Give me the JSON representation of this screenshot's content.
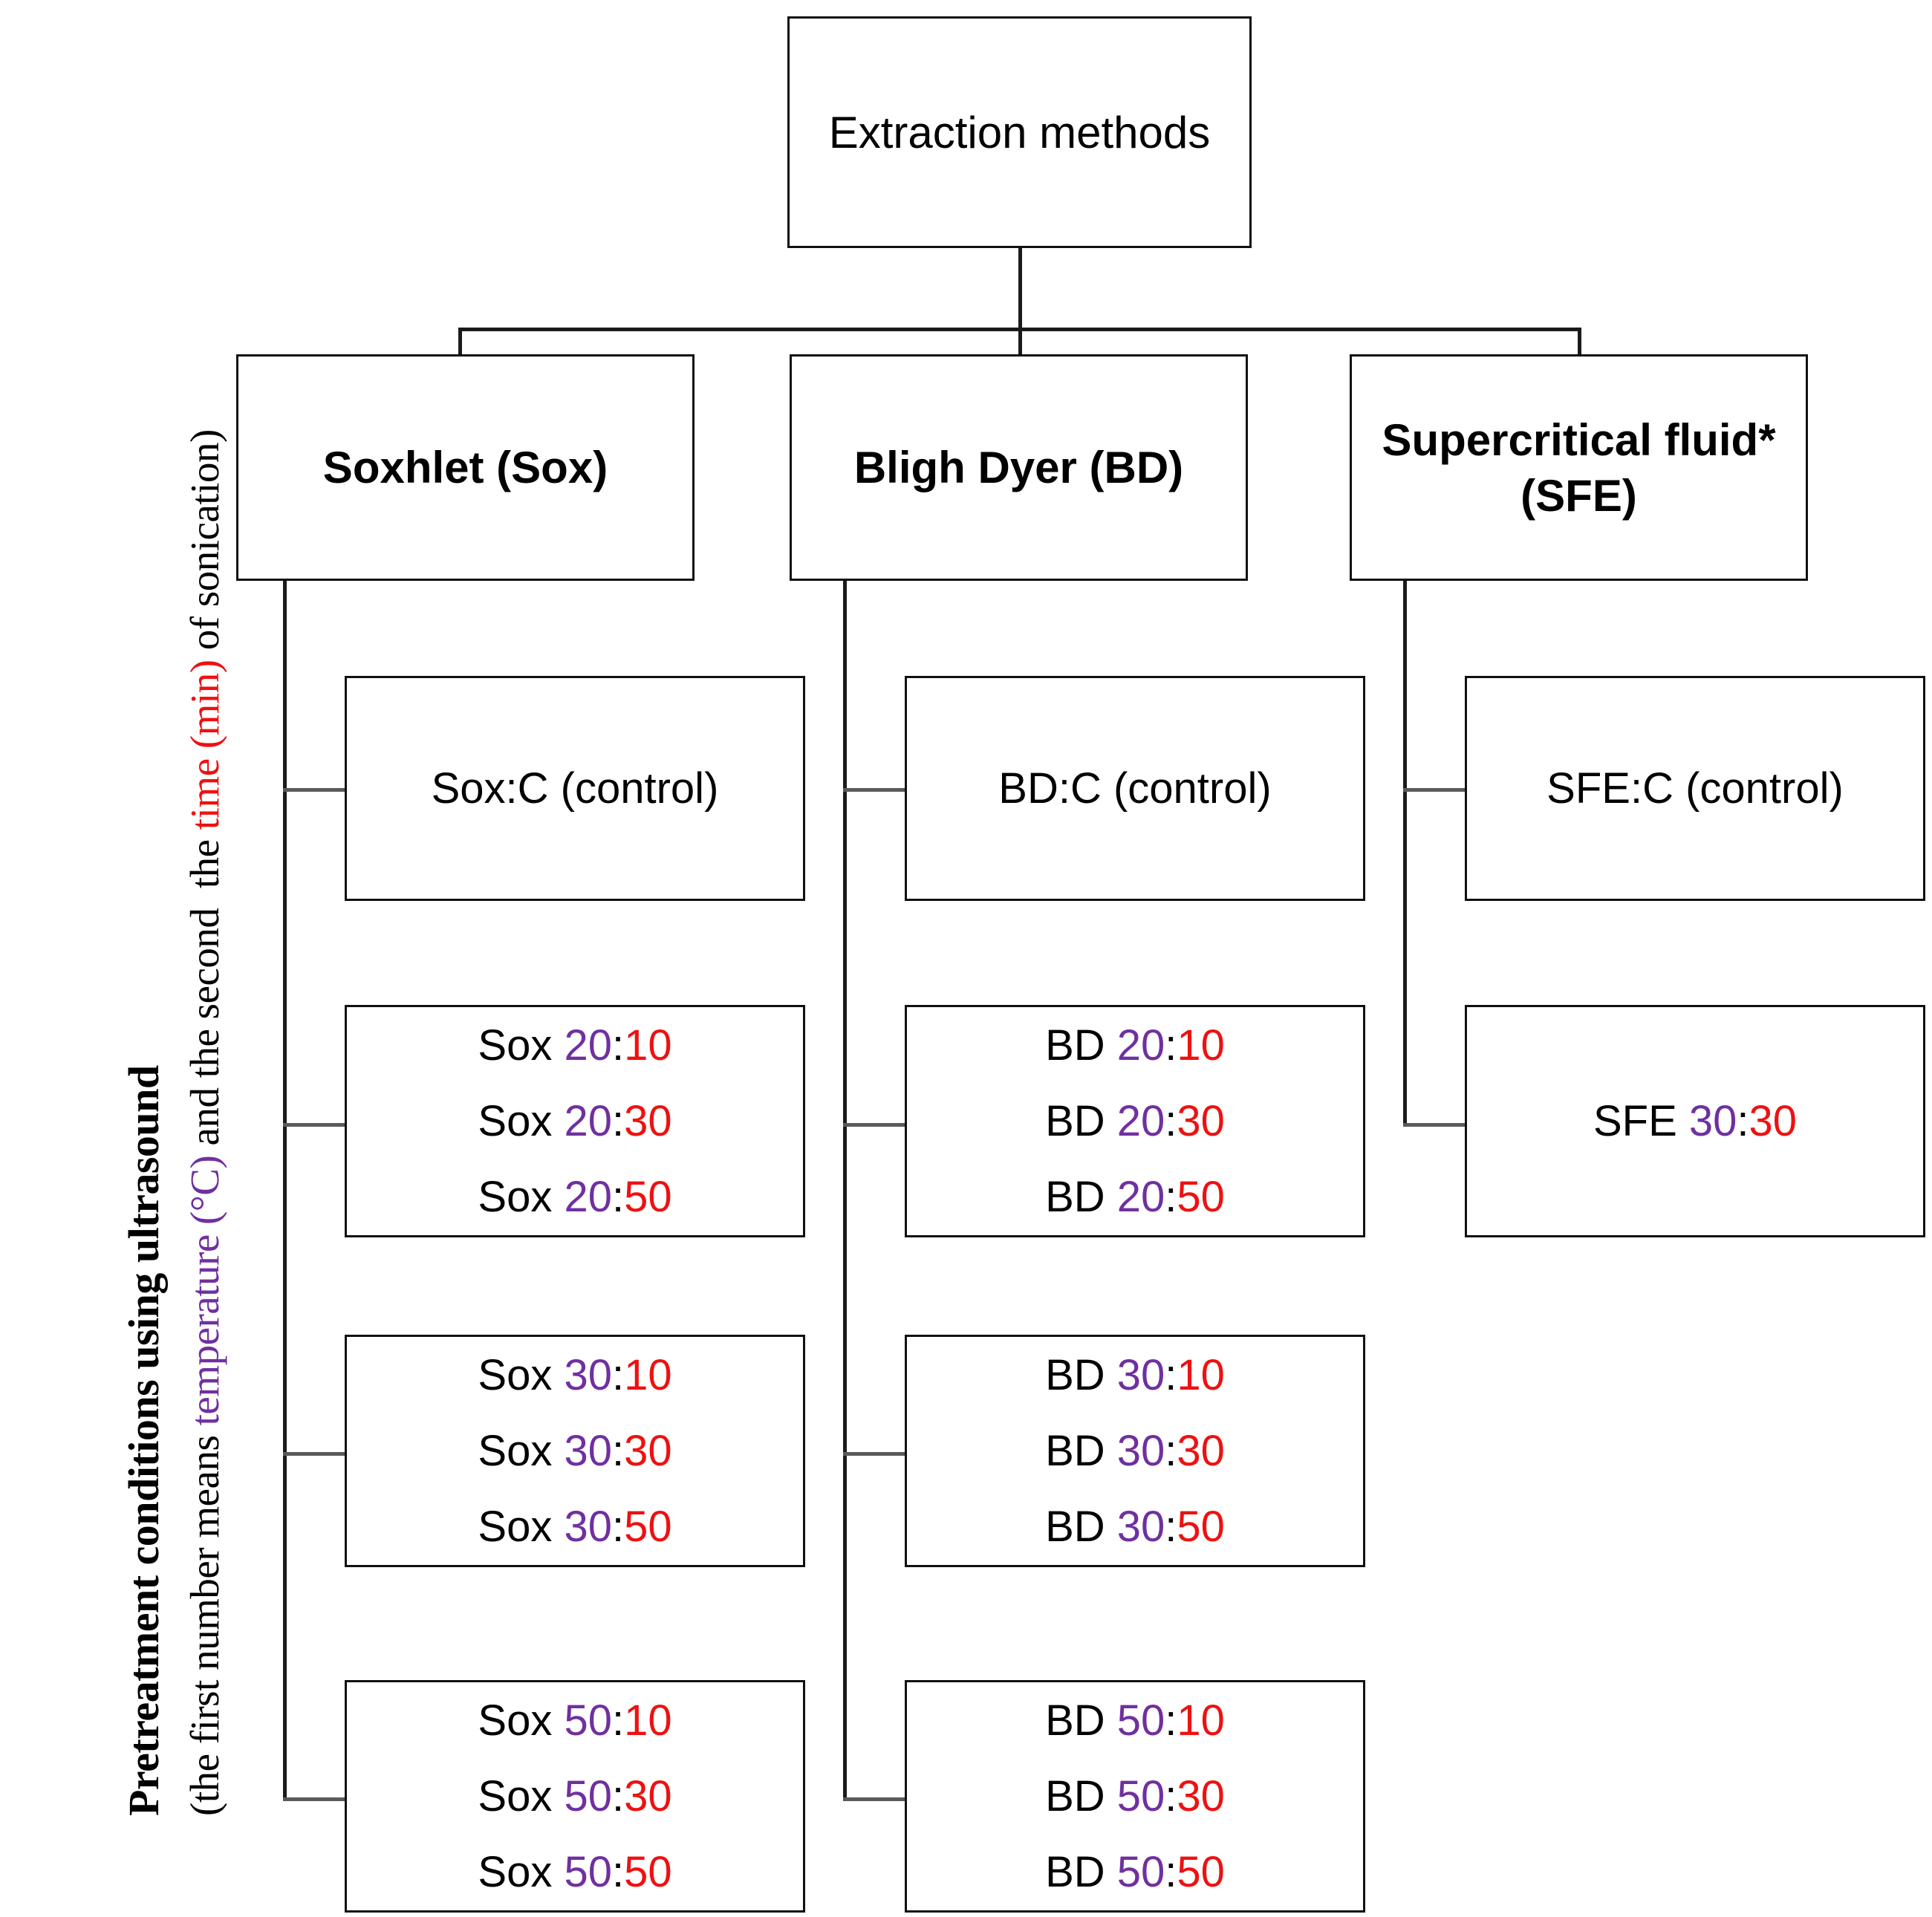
{
  "diagram": {
    "title": "Extraction methods flowchart",
    "root": {
      "label": "Extraction methods"
    },
    "side_caption": {
      "line1": "Pretreatment conditions using ultrasound",
      "line2_a": "(the first number means ",
      "line2_temperature": "temperature (°C)",
      "line2_b": " and the second",
      "line3_a": "the ",
      "line3_time": "time (min)",
      "line3_b": " of sonication)"
    },
    "colors": {
      "temperature_purple": "#7030A0",
      "time_red": "#EE1111",
      "box_border": "#111111",
      "connector": "#1B1B1B",
      "stub": "#5A5A5A"
    },
    "columns": [
      {
        "id": "sox",
        "method_label": "Soxhlet (Sox)",
        "children": [
          {
            "id": "sox-control",
            "type": "single",
            "rows": [
              {
                "prefix": "Sox:C (control)",
                "temp": "",
                "sep": "",
                "time": ""
              }
            ]
          },
          {
            "id": "sox-20",
            "type": "triple",
            "rows": [
              {
                "prefix": "Sox ",
                "temp": "20",
                "sep": ":",
                "time": "10"
              },
              {
                "prefix": "Sox ",
                "temp": "20",
                "sep": ":",
                "time": "30"
              },
              {
                "prefix": "Sox ",
                "temp": "20",
                "sep": ":",
                "time": "50"
              }
            ]
          },
          {
            "id": "sox-30",
            "type": "triple",
            "rows": [
              {
                "prefix": "Sox ",
                "temp": "30",
                "sep": ":",
                "time": "10"
              },
              {
                "prefix": "Sox ",
                "temp": "30",
                "sep": ":",
                "time": "30"
              },
              {
                "prefix": "Sox ",
                "temp": "30",
                "sep": ":",
                "time": "50"
              }
            ]
          },
          {
            "id": "sox-50",
            "type": "triple",
            "rows": [
              {
                "prefix": "Sox ",
                "temp": "50",
                "sep": ":",
                "time": "10"
              },
              {
                "prefix": "Sox ",
                "temp": "50",
                "sep": ":",
                "time": "30"
              },
              {
                "prefix": "Sox ",
                "temp": "50",
                "sep": ":",
                "time": "50"
              }
            ]
          }
        ]
      },
      {
        "id": "bd",
        "method_label": "Bligh Dyer (BD)",
        "children": [
          {
            "id": "bd-control",
            "type": "single",
            "rows": [
              {
                "prefix": "BD:C (control)",
                "temp": "",
                "sep": "",
                "time": ""
              }
            ]
          },
          {
            "id": "bd-20",
            "type": "triple",
            "rows": [
              {
                "prefix": "BD ",
                "temp": "20",
                "sep": ":",
                "time": "10"
              },
              {
                "prefix": "BD ",
                "temp": "20",
                "sep": ":",
                "time": "30"
              },
              {
                "prefix": "BD ",
                "temp": "20",
                "sep": ":",
                "time": "50"
              }
            ]
          },
          {
            "id": "bd-30",
            "type": "triple",
            "rows": [
              {
                "prefix": "BD ",
                "temp": "30",
                "sep": ":",
                "time": "10"
              },
              {
                "prefix": "BD ",
                "temp": "30",
                "sep": ":",
                "time": "30"
              },
              {
                "prefix": "BD ",
                "temp": "30",
                "sep": ":",
                "time": "50"
              }
            ]
          },
          {
            "id": "bd-50",
            "type": "triple",
            "rows": [
              {
                "prefix": "BD ",
                "temp": "50",
                "sep": ":",
                "time": "10"
              },
              {
                "prefix": "BD ",
                "temp": "50",
                "sep": ":",
                "time": "30"
              },
              {
                "prefix": "BD ",
                "temp": "50",
                "sep": ":",
                "time": "50"
              }
            ]
          }
        ]
      },
      {
        "id": "sfe",
        "method_label_line1": "Supercritical fluid*",
        "method_label_line2": "(SFE)",
        "children": [
          {
            "id": "sfe-control",
            "type": "single",
            "rows": [
              {
                "prefix": "SFE:C (control)",
                "temp": "",
                "sep": "",
                "time": ""
              }
            ]
          },
          {
            "id": "sfe-30",
            "type": "single",
            "rows": [
              {
                "prefix": "SFE ",
                "temp": "30",
                "sep": ":",
                "time": "30"
              }
            ]
          }
        ]
      }
    ]
  }
}
